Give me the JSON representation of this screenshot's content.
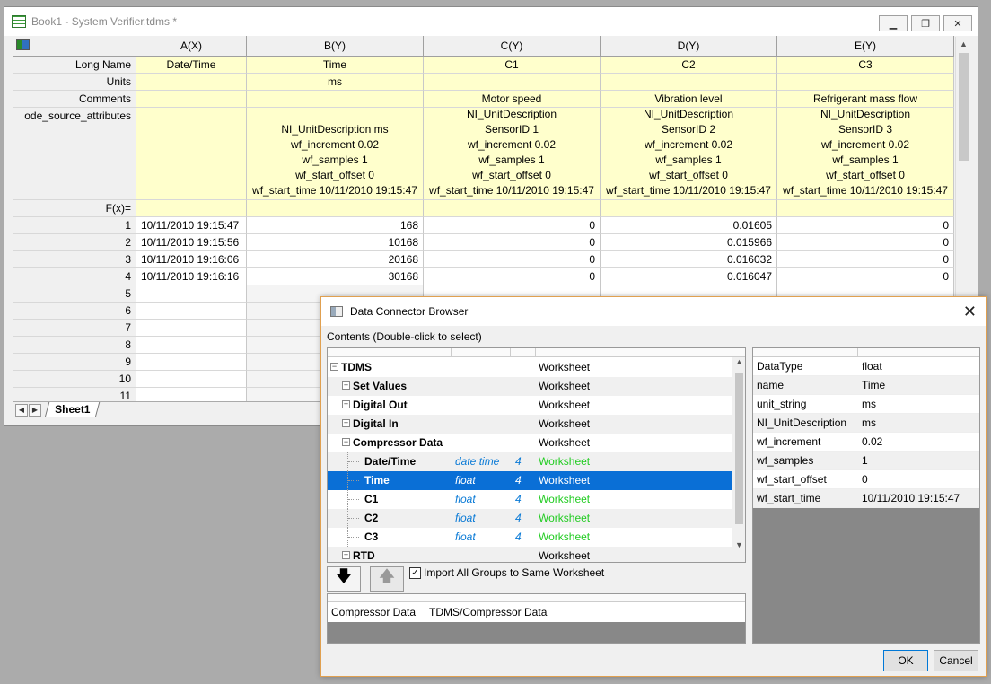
{
  "workbook": {
    "title": "Book1 - System Verifier.tdms *",
    "columns": [
      "A(X)",
      "B(Y)",
      "C(Y)",
      "D(Y)",
      "E(Y)"
    ],
    "row_labels": {
      "long_name": "Long Name",
      "units": "Units",
      "comments": "Comments",
      "attrs": "ode_source_attributes",
      "fx": "F(x)="
    },
    "long_names": [
      "Date/Time",
      "Time",
      "C1",
      "C2",
      "C3"
    ],
    "units": [
      "",
      "ms",
      "",
      "",
      ""
    ],
    "comments": [
      "",
      "",
      "Motor speed",
      "Vibration level",
      "Refrigerant mass flow"
    ],
    "attrs": [
      [],
      [
        "NI_UnitDescription  ms",
        "wf_increment  0.02",
        "wf_samples  1",
        "wf_start_offset  0",
        "wf_start_time  10/11/2010 19:15:47"
      ],
      [
        "NI_UnitDescription",
        "SensorID  1",
        "wf_increment  0.02",
        "wf_samples  1",
        "wf_start_offset  0",
        "wf_start_time  10/11/2010 19:15:47"
      ],
      [
        "NI_UnitDescription",
        "SensorID  2",
        "wf_increment  0.02",
        "wf_samples  1",
        "wf_start_offset  0",
        "wf_start_time  10/11/2010 19:15:47"
      ],
      [
        "NI_UnitDescription",
        "SensorID  3",
        "wf_increment  0.02",
        "wf_samples  1",
        "wf_start_offset  0",
        "wf_start_time  10/11/2010 19:15:47"
      ]
    ],
    "rows": [
      {
        "n": "1",
        "cells": [
          "10/11/2010 19:15:47",
          "168",
          "0",
          "0.01605",
          "0"
        ]
      },
      {
        "n": "2",
        "cells": [
          "10/11/2010 19:15:56",
          "10168",
          "0",
          "0.015966",
          "0"
        ]
      },
      {
        "n": "3",
        "cells": [
          "10/11/2010 19:16:06",
          "20168",
          "0",
          "0.016032",
          "0"
        ]
      },
      {
        "n": "4",
        "cells": [
          "10/11/2010 19:16:16",
          "30168",
          "0",
          "0.016047",
          "0"
        ]
      },
      {
        "n": "5",
        "cells": [
          "",
          "",
          "",
          "",
          ""
        ]
      },
      {
        "n": "6",
        "cells": [
          "",
          "",
          "",
          "",
          ""
        ]
      },
      {
        "n": "7",
        "cells": [
          "",
          "",
          "",
          "",
          ""
        ]
      },
      {
        "n": "8",
        "cells": [
          "",
          "",
          "",
          "",
          ""
        ]
      },
      {
        "n": "9",
        "cells": [
          "",
          "",
          "",
          "",
          ""
        ]
      },
      {
        "n": "10",
        "cells": [
          "",
          "",
          "",
          "",
          ""
        ]
      },
      {
        "n": "11",
        "cells": [
          "",
          "",
          "",
          "",
          ""
        ]
      }
    ],
    "sheet_tab": "Sheet1"
  },
  "dialog": {
    "title": "Data Connector Browser",
    "contents_label": "Contents (Double-click to select)",
    "tree": [
      {
        "name": "TDMS",
        "level": 0,
        "exp": "−",
        "type": "",
        "num": "",
        "kind": "Worksheet",
        "green": false,
        "alt": false,
        "sel": false
      },
      {
        "name": "Set Values",
        "level": 1,
        "exp": "+",
        "type": "",
        "num": "",
        "kind": "Worksheet",
        "green": false,
        "alt": true,
        "sel": false
      },
      {
        "name": "Digital Out",
        "level": 1,
        "exp": "+",
        "type": "",
        "num": "",
        "kind": "Worksheet",
        "green": false,
        "alt": false,
        "sel": false
      },
      {
        "name": "Digital In",
        "level": 1,
        "exp": "+",
        "type": "",
        "num": "",
        "kind": "Worksheet",
        "green": false,
        "alt": true,
        "sel": false
      },
      {
        "name": "Compressor Data",
        "level": 1,
        "exp": "−",
        "type": "",
        "num": "",
        "kind": "Worksheet",
        "green": false,
        "alt": false,
        "sel": false
      },
      {
        "name": "Date/Time",
        "level": 2,
        "exp": "",
        "type": "date time",
        "num": "4",
        "kind": "Worksheet",
        "green": true,
        "alt": true,
        "sel": false
      },
      {
        "name": "Time",
        "level": 2,
        "exp": "",
        "type": "float",
        "num": "4",
        "kind": "Worksheet",
        "green": true,
        "alt": false,
        "sel": true
      },
      {
        "name": "C1",
        "level": 2,
        "exp": "",
        "type": "float",
        "num": "4",
        "kind": "Worksheet",
        "green": true,
        "alt": false,
        "sel": false
      },
      {
        "name": "C2",
        "level": 2,
        "exp": "",
        "type": "float",
        "num": "4",
        "kind": "Worksheet",
        "green": true,
        "alt": true,
        "sel": false
      },
      {
        "name": "C3",
        "level": 2,
        "exp": "",
        "type": "float",
        "num": "4",
        "kind": "Worksheet",
        "green": true,
        "alt": false,
        "sel": false
      },
      {
        "name": "RTD",
        "level": 1,
        "exp": "+",
        "type": "",
        "num": "",
        "kind": "Worksheet",
        "green": false,
        "alt": true,
        "sel": false
      }
    ],
    "import_all_label": "Import All Groups to Same Worksheet",
    "import_all_checked": "✓",
    "selected": {
      "name": "Compressor Data",
      "path": "TDMS/Compressor Data"
    },
    "props": [
      {
        "k": "DataType",
        "v": "float"
      },
      {
        "k": "name",
        "v": "Time"
      },
      {
        "k": "unit_string",
        "v": "ms"
      },
      {
        "k": "NI_UnitDescription",
        "v": "ms"
      },
      {
        "k": "wf_increment",
        "v": "0.02"
      },
      {
        "k": "wf_samples",
        "v": "1"
      },
      {
        "k": "wf_start_offset",
        "v": "0"
      },
      {
        "k": "wf_start_time",
        "v": "10/11/2010 19:15:47"
      }
    ],
    "ok_label": "OK",
    "cancel_label": "Cancel",
    "close_glyph": "✕",
    "down_arrow": "🡇",
    "up_arrow": "🡅"
  },
  "colors": {
    "selected_row": "#0a6fd6",
    "label_yellow": "#ffffcc",
    "green_text": "#22cc22",
    "type_blue": "#0a7ad6"
  }
}
